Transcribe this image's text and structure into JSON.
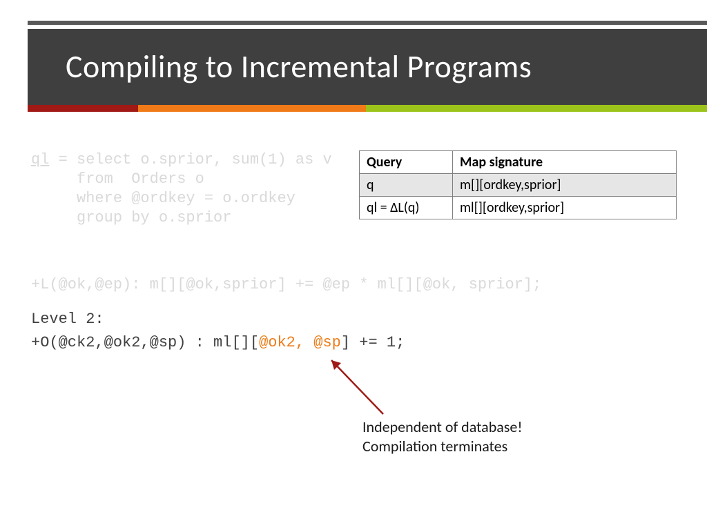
{
  "header": {
    "title": "Compiling to Incremental Programs"
  },
  "code": {
    "ql_label": "ql",
    "ql_rest": " = select o.sprior, sum(1) as v\n     from  Orders o\n     where @ordkey = o.ordkey\n     group by o.sprior",
    "rule_line": "+L(@ok,@ep): m[][@ok,sprior] += @ep * ml[][@ok, sprior];",
    "level2_label": "Level 2:",
    "l2_prefix": "+O(@ck2,@ok2,@sp) : ml[][",
    "l2_arg1": "@ok2",
    "l2_comma": ", ",
    "l2_arg2": "@sp",
    "l2_suffix": "] += 1;"
  },
  "table": {
    "h1": "Query",
    "h2": "Map signature",
    "r1c1": "q",
    "r1c2": "m[][ordkey,sprior]",
    "r2c1": "ql = ΔL(q)",
    "r2c2": "ml[][ordkey,sprior]"
  },
  "annotation": {
    "line1": "Independent of database!",
    "line2": "Compilation terminates"
  }
}
